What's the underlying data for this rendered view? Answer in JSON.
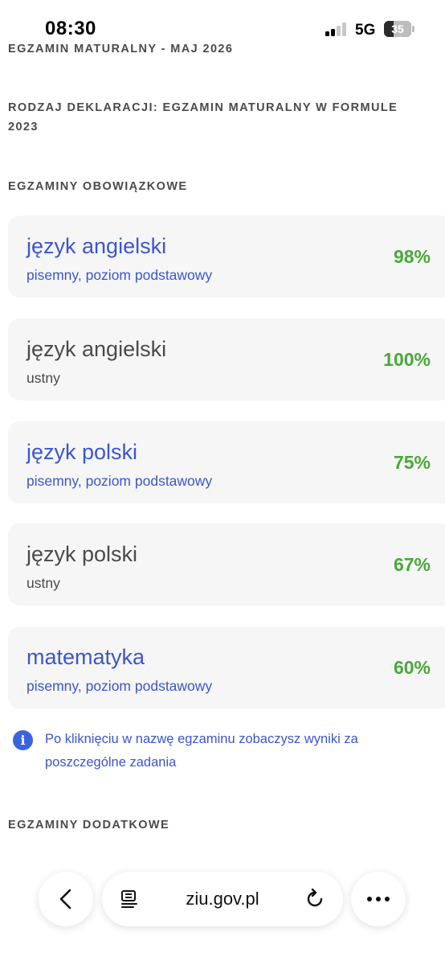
{
  "status_bar": {
    "time": "08:30",
    "network": "5G",
    "battery": 35,
    "signal_bars_active": 2,
    "signal_bars_total": 4
  },
  "header": {
    "title": "EGZAMIN MATURALNY - MAJ 2026",
    "declaration": "RODZAJ DEKLARACJI: EGZAMIN MATURALNY W FORMULE 2023"
  },
  "sections": {
    "mandatory": "EGZAMINY OBOWIĄZKOWE",
    "additional": "EGZAMINY DODATKOWE"
  },
  "exams": [
    {
      "name": "język angielski",
      "type": "pisemny, poziom podstawowy",
      "score": "98%",
      "link": true
    },
    {
      "name": "język angielski",
      "type": "ustny",
      "score": "100%",
      "link": false
    },
    {
      "name": "język polski",
      "type": "pisemny, poziom podstawowy",
      "score": "75%",
      "link": true
    },
    {
      "name": "język polski",
      "type": "ustny",
      "score": "67%",
      "link": false
    },
    {
      "name": "matematyka",
      "type": "pisemny, poziom podstawowy",
      "score": "60%",
      "link": true
    }
  ],
  "info": {
    "icon": "info-icon",
    "text": "Po kliknięciu w nazwę egzaminu zobaczysz wyniki za poszczególne zadania"
  },
  "browser": {
    "url": "ziu.gov.pl",
    "back_icon": "chevron-left-icon",
    "reader_icon": "reader-icon",
    "reload_icon": "reload-icon",
    "more_icon": "more-dots-icon"
  },
  "colors": {
    "link": "#3b55d6",
    "score": "#4aa83a",
    "card_bg": "#f6f6f6",
    "info_icon": "#3b63e0"
  }
}
